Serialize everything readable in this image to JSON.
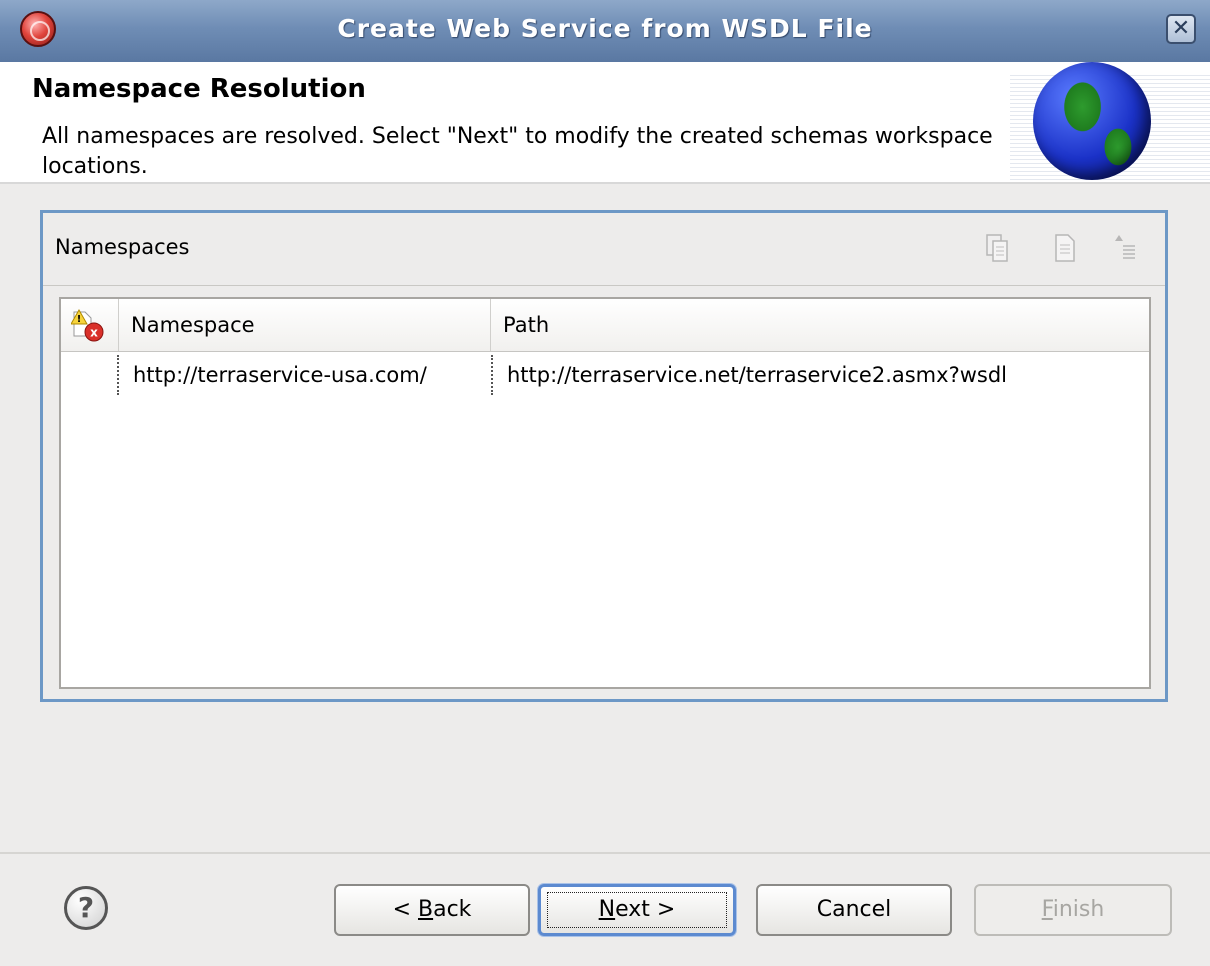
{
  "window": {
    "title": "Create Web Service from WSDL File",
    "close_label": "✕"
  },
  "header": {
    "title": "Namespace Resolution",
    "description": "All namespaces are resolved. Select \"Next\" to modify the created schemas workspace locations."
  },
  "namespaces_section": {
    "title": "Namespaces",
    "toolbar_icons": [
      "paste-icon",
      "document-icon",
      "sort-icon"
    ],
    "table": {
      "columns": [
        "Namespace",
        "Path"
      ],
      "rows": [
        {
          "namespace": "http://terraservice-usa.com/",
          "path": "http://terraservice.net/terraservice2.asmx?wsdl"
        }
      ]
    }
  },
  "buttons": {
    "back": {
      "prefix": "< ",
      "mnemonic": "B",
      "rest": "ack"
    },
    "next": {
      "mnemonic": "N",
      "rest": "ext >"
    },
    "cancel": "Cancel",
    "finish": {
      "mnemonic": "F",
      "rest": "inish"
    }
  },
  "colors": {
    "titlebar": "#6f8db5",
    "section_border": "#6d98c6",
    "dialog_bg": "#edeceb"
  }
}
